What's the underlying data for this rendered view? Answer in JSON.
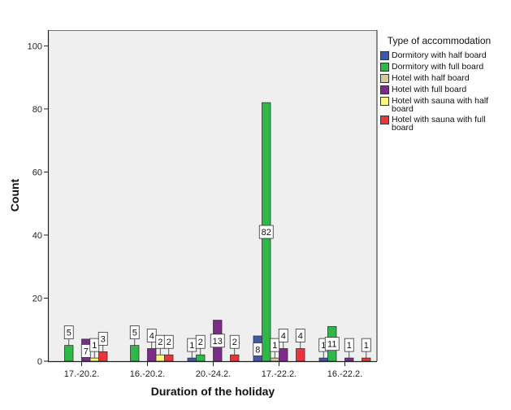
{
  "chart_data": {
    "type": "bar",
    "title": "",
    "xlabel": "Duration of the holiday",
    "ylabel": "Count",
    "ylim": [
      0,
      105
    ],
    "yticks": [
      0,
      20,
      40,
      60,
      80,
      100
    ],
    "grid": false,
    "legend_title": "Type of accommodation",
    "legend_position": "right",
    "categories": [
      "17.-20.2.",
      "16.-20.2.",
      "20.-24.2.",
      "17.-22.2.",
      "16.-22.2."
    ],
    "series": [
      {
        "name": "Dormitory with half board",
        "color": "#3e58ac",
        "values": [
          0,
          0,
          1,
          8,
          1
        ]
      },
      {
        "name": "Dormitory with full board",
        "color": "#2eb848",
        "values": [
          5,
          5,
          2,
          82,
          11
        ]
      },
      {
        "name": "Hotel with half board",
        "color": "#d2cc9c",
        "values": [
          0,
          0,
          0,
          1,
          0
        ]
      },
      {
        "name": "Hotel with full board",
        "color": "#7c2a8c",
        "values": [
          7,
          4,
          13,
          4,
          1
        ]
      },
      {
        "name": "Hotel with sauna with half board",
        "color": "#fbf873",
        "values": [
          1,
          2,
          0,
          0,
          0
        ]
      },
      {
        "name": "Hotel with sauna with full board",
        "color": "#ef3338",
        "values": [
          3,
          2,
          2,
          4,
          1
        ]
      }
    ]
  }
}
